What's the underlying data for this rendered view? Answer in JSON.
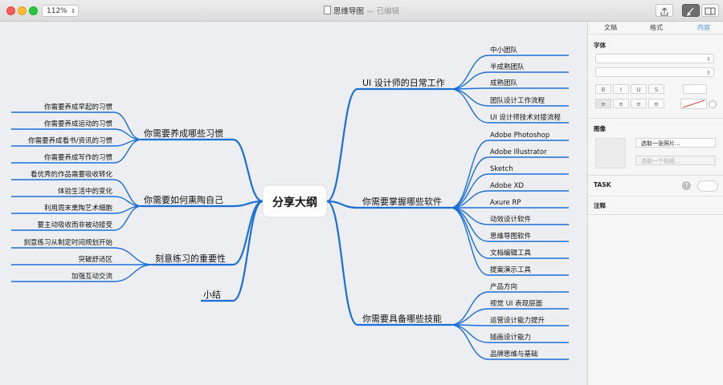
{
  "toolbar": {
    "zoom": "112%",
    "title": "思维导图",
    "subtitle": " — 已编辑"
  },
  "mindmap": {
    "central": "分享大纲",
    "branches": [
      {
        "label": "UI 设计师的日常工作",
        "children": [
          "中小团队",
          "半成熟团队",
          "成熟团队",
          "团队设计工作流程",
          "UI 设计师技术对接流程"
        ]
      },
      {
        "label": "你需要掌握哪些软件",
        "children": [
          "Adobe Photoshop",
          "Adobe Illustrator",
          "Sketch",
          "Adobe XD",
          "Axure RP",
          "动效设计软件",
          "思维导图软件",
          "文档编辑工具",
          "提案演示工具"
        ]
      },
      {
        "label": "你需要具备哪些技能",
        "children": [
          "产品方向",
          "视觉 UI 表现层面",
          "运营设计能力提升",
          "插画设计能力",
          "品牌思维与基础"
        ]
      },
      {
        "label": "你需要养成哪些习惯",
        "children": [
          "你需要养成早起的习惯",
          "你需要养成运动的习惯",
          "你需要养成看书/资讯的习惯",
          "你需要养成写作的习惯"
        ]
      },
      {
        "label": "你需要如何熏陶自己",
        "children": [
          "看优秀的作品需要吸收转化",
          "体验生活中的变化",
          "利用周末熏陶艺术细胞",
          "要主动吸收而非被动接受"
        ]
      },
      {
        "label": "刻意练习的重要性",
        "children": [
          "刻意练习从制定时间规划开始",
          "突破舒适区",
          "加强互动交流"
        ]
      },
      {
        "label": "小结",
        "children": []
      }
    ]
  },
  "inspector": {
    "tabs": [
      "文稿",
      "格式",
      "内容"
    ],
    "font_section": "字体",
    "style_buttons": [
      "B",
      "I",
      "U",
      "S"
    ],
    "image_section": "图像",
    "choose_photo": "选取一张照片...",
    "choose_sticker": "选取一个贴纸...",
    "task_section": "TASK",
    "help": "?",
    "notes_section": "注释"
  },
  "colors": {
    "line": "#1b6fd6",
    "accent": "#4a90e2"
  }
}
